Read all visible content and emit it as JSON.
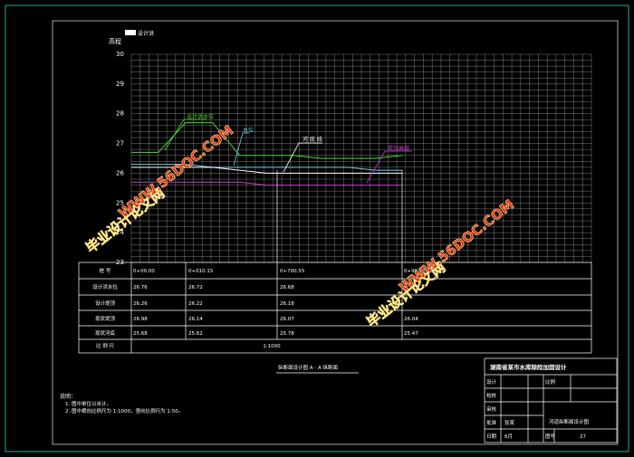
{
  "legend_label": "设计洪",
  "y_axis": {
    "title": "高程",
    "ticks": [
      30,
      29,
      28,
      27,
      26,
      25,
      24,
      23
    ],
    "range": [
      23,
      30
    ]
  },
  "chart_data": {
    "type": "line",
    "x": [
      0,
      0.5,
      1.0,
      1.5,
      2.0,
      2.5,
      3.0,
      3.5,
      4.0,
      4.5,
      5.0
    ],
    "series": [
      {
        "name": "",
        "color": "#4ddc3a",
        "values": [
          26.7,
          26.7,
          27.7,
          27.7,
          26.6,
          26.6,
          26.6,
          26.5,
          26.5,
          26.5,
          26.6
        ]
      },
      {
        "name": "",
        "color": "#6fd0e8",
        "values": [
          26.3,
          26.3,
          26.3,
          26.2,
          26.2,
          26.2,
          26.2,
          26.2,
          26.2,
          26.1,
          26.1
        ]
      },
      {
        "name": "",
        "color": "#ffffff",
        "values": [
          26.2,
          26.2,
          26.2,
          26.2,
          26.1,
          26.0,
          26.0,
          26.0,
          26.0,
          26.0,
          26.0
        ]
      },
      {
        "name": "",
        "color": "#c53fc8",
        "values": [
          25.7,
          25.7,
          25.7,
          25.7,
          25.7,
          25.6,
          25.6,
          25.6,
          25.6,
          25.6,
          25.6
        ]
      }
    ],
    "ylim": [
      23,
      30
    ]
  },
  "annotations": [
    "设计洪水位",
    "水位",
    "河 底 线",
    "堤顶高程"
  ],
  "table": {
    "row_headers": [
      "桩 号",
      "设计洪水位",
      "设计堤顶",
      "现状堤顶",
      "现状河底",
      "比 例 尺"
    ],
    "col1": [
      "0+00.00",
      "26.76",
      "26.26",
      "26.98",
      "25.68"
    ],
    "col2": [
      "0+010.15",
      "26.72",
      "26.22",
      "26.14",
      "25.62"
    ],
    "col3": [
      "0+700.55",
      "26.68",
      "26.18",
      "26.07",
      "25.78"
    ],
    "col4": [
      "0+983.36",
      "",
      "",
      "26.04",
      "25.47"
    ],
    "scale": "1:1000"
  },
  "sub_caption": "纵断面设计图 A - A 纵断面",
  "notes": {
    "title": "说明：",
    "items": [
      "1. 图中单位以米计。",
      "2. 图中横向比例尺为 1:1000，竖向比例尺为 1:50。"
    ]
  },
  "title_block": {
    "project": "湖南省某市水库除险加固设计",
    "labels": [
      "设计",
      "校核",
      "审核",
      "批准",
      "日期"
    ],
    "values": [
      "",
      "",
      "",
      "张某",
      "6月"
    ],
    "mid_labels": [
      "比例",
      "",
      "",
      "",
      "图号"
    ],
    "mid_values": [
      "",
      "",
      "",
      "",
      "27"
    ],
    "right_top": "",
    "drawing_title": "河道纵断面设计图",
    "sheet_label": "图号",
    "sheet_no": "27"
  },
  "watermark": {
    "line1": "毕业设计论文网",
    "line2": "WWW.56DOC.COM"
  },
  "colors": {
    "grid": "#ffffff",
    "green": "#4ddc3a",
    "cyan": "#6fd0e8",
    "magenta": "#c53fc8",
    "watermark": "#e8321e",
    "frame": "#2aa8a0"
  }
}
